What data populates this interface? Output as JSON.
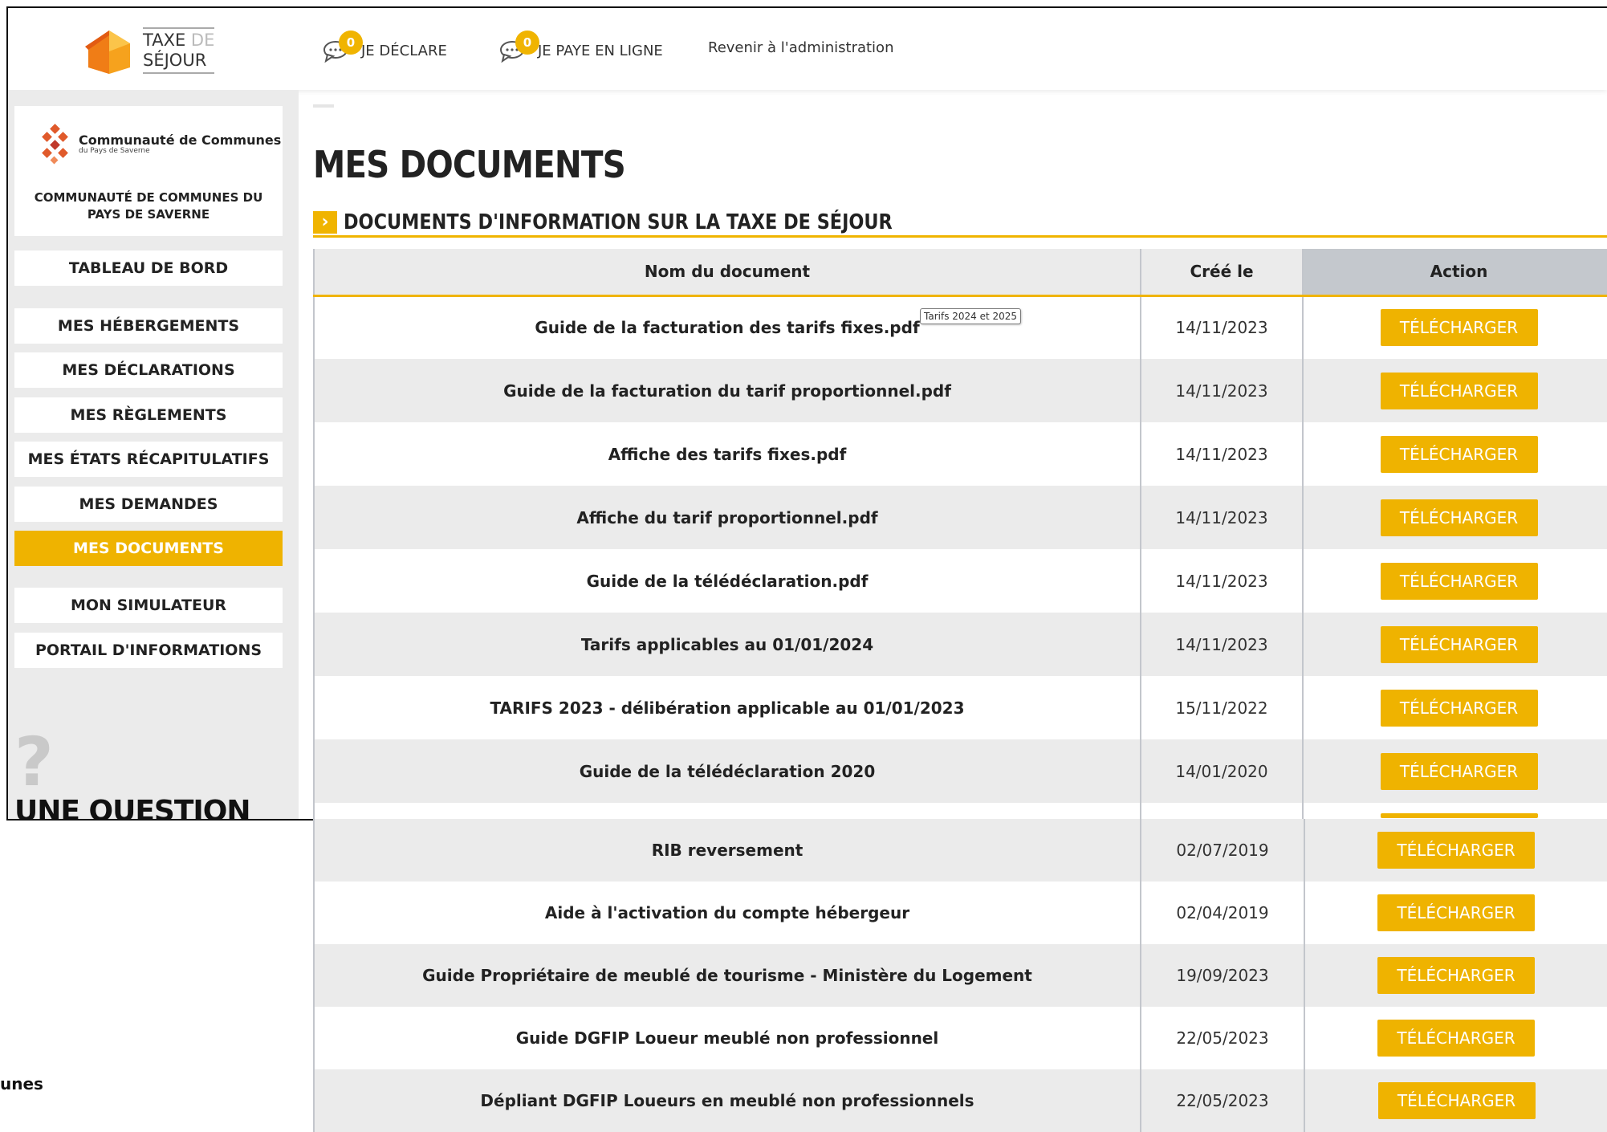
{
  "header": {
    "logo_line1": "TAXE",
    "logo_line1_suffix": "DE",
    "logo_line2": "SÉJOUR",
    "nav": [
      {
        "label": "JE DÉCLARE",
        "badge": "0"
      },
      {
        "label": "JE PAYE EN LIGNE",
        "badge": "0"
      },
      {
        "label": "Revenir à l'administration"
      }
    ]
  },
  "org": {
    "logo_title": "Communauté de Communes",
    "logo_sub": "du Pays de Saverne",
    "name_line1": "COMMUNAUTÉ DE COMMUNES DU",
    "name_line2": "PAYS DE SAVERNE"
  },
  "sidebar": {
    "items": [
      {
        "label": "TABLEAU DE BORD"
      },
      {
        "label": "MES HÉBERGEMENTS"
      },
      {
        "label": "MES DÉCLARATIONS"
      },
      {
        "label": "MES RÈGLEMENTS"
      },
      {
        "label": "MES ÉTATS RÉCAPITULATIFS"
      },
      {
        "label": "MES DEMANDES"
      },
      {
        "label": "MES DOCUMENTS",
        "active": true
      },
      {
        "label": "MON SIMULATEUR"
      },
      {
        "label": "PORTAIL D'INFORMATIONS"
      }
    ],
    "question_mark": "?",
    "question": "UNE QUESTION",
    "cut_text": "unes"
  },
  "main": {
    "title": "MES DOCUMENTS",
    "section_title": "DOCUMENTS D'INFORMATION SUR LA TAXE DE SÉJOUR",
    "section_arrow": "›",
    "tooltip": "Tarifs 2024 et 2025",
    "table": {
      "headers": [
        "Nom du document",
        "Créé le",
        "Action"
      ],
      "rows_top": [
        {
          "name": "Guide de la facturation des tarifs fixes.pdf",
          "date": "14/11/2023",
          "action": "TÉLÉCHARGER"
        },
        {
          "name": "Guide de la facturation du tarif proportionnel.pdf",
          "date": "14/11/2023",
          "action": "TÉLÉCHARGER"
        },
        {
          "name": "Affiche des tarifs fixes.pdf",
          "date": "14/11/2023",
          "action": "TÉLÉCHARGER"
        },
        {
          "name": "Affiche du tarif proportionnel.pdf",
          "date": "14/11/2023",
          "action": "TÉLÉCHARGER"
        },
        {
          "name": "Guide de la télédéclaration.pdf",
          "date": "14/11/2023",
          "action": "TÉLÉCHARGER"
        },
        {
          "name": "Tarifs applicables au 01/01/2024",
          "date": "14/11/2023",
          "action": "TÉLÉCHARGER"
        },
        {
          "name": "TARIFS 2023 - délibération applicable au 01/01/2023",
          "date": "15/11/2022",
          "action": "TÉLÉCHARGER"
        },
        {
          "name": "Guide de la télédéclaration 2020",
          "date": "14/01/2020",
          "action": "TÉLÉCHARGER"
        }
      ],
      "rows_bottom": [
        {
          "name": "RIB reversement",
          "date": "02/07/2019",
          "action": "TÉLÉCHARGER"
        },
        {
          "name": "Aide à l'activation du compte hébergeur",
          "date": "02/04/2019",
          "action": "TÉLÉCHARGER"
        },
        {
          "name": "Guide Propriétaire de meublé de tourisme - Ministère du Logement",
          "date": "19/09/2023",
          "action": "TÉLÉCHARGER"
        },
        {
          "name": "Guide DGFIP Loueur meublé non professionnel",
          "date": "22/05/2023",
          "action": "TÉLÉCHARGER"
        },
        {
          "name": "Dépliant DGFIP Loueurs en meublé non professionnels",
          "date": "22/05/2023",
          "action": "TÉLÉCHARGER"
        }
      ]
    }
  }
}
